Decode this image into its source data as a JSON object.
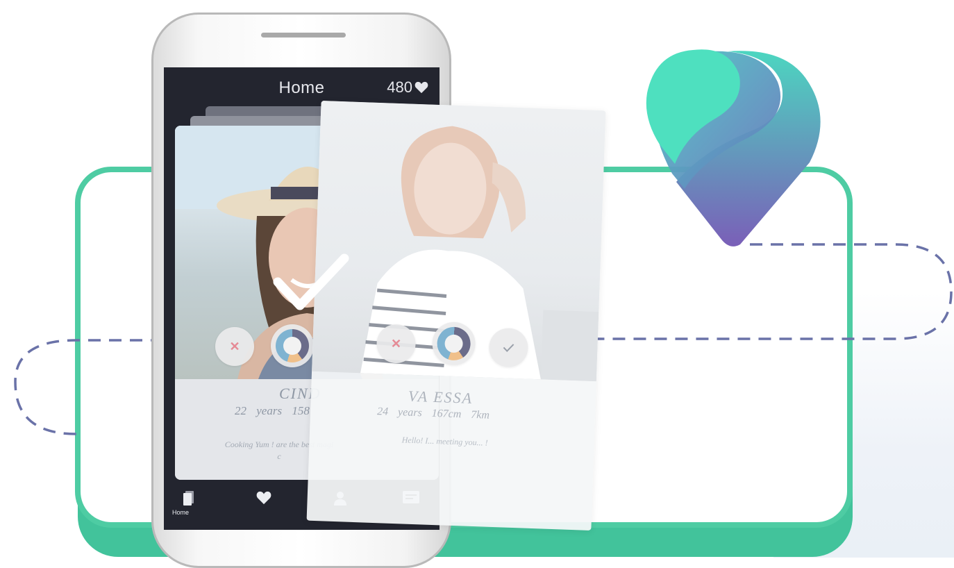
{
  "colors": {
    "accent_green": "#4ecca3",
    "dashed_line": "#6a72a8",
    "screen_dark": "#23252f",
    "logo_gradient": [
      "#4de0c0",
      "#5aa7c8",
      "#7a5fb8"
    ]
  },
  "screen": {
    "title": "Home",
    "points": "480",
    "points_icon": "heart-icon"
  },
  "cards": [
    {
      "name": "CIND",
      "meta": "22 years 158",
      "bio": "Cooking Yum ! are the best magi c"
    },
    {
      "name": "VA ESSA",
      "meta": "24 years 167cm 7km",
      "bio": "Hello! I... meeting you... !"
    }
  ],
  "nav": {
    "items": [
      {
        "icon": "cards-icon",
        "label": "Home"
      },
      {
        "icon": "heart-icon",
        "label": ""
      },
      {
        "icon": "person-icon",
        "label": ""
      },
      {
        "icon": "chat-icon",
        "label": ""
      }
    ]
  },
  "logo": {
    "icon": "location-pin-logo"
  }
}
